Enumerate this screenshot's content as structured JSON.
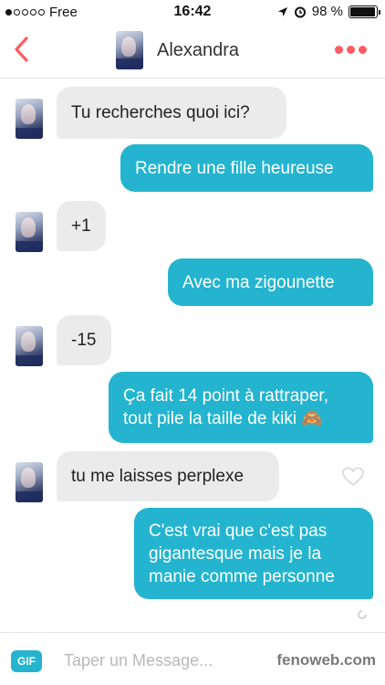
{
  "status_bar": {
    "carrier": "Free",
    "time": "16:42",
    "battery": "98 %",
    "battery_level": 0.98,
    "signal_bars": 1,
    "icons": [
      "location-icon",
      "alarm-icon",
      "battery-icon"
    ]
  },
  "header": {
    "contact_name": "Alexandra",
    "back_icon": "chevron-left-icon",
    "menu_icon": "more-dots-icon"
  },
  "messages": [
    {
      "from": "them",
      "text": "Tu recherches quoi ici?"
    },
    {
      "from": "me",
      "text": "Rendre une fille heureuse"
    },
    {
      "from": "them",
      "text": "+1"
    },
    {
      "from": "me",
      "text": "Avec ma zigounette"
    },
    {
      "from": "them",
      "text": "-15"
    },
    {
      "from": "me",
      "lines": [
        "Ça fait 14 point à rattraper,",
        "tout pile la taille de kiki 🙈"
      ]
    },
    {
      "from": "them",
      "text": "tu me laisses perplexe"
    },
    {
      "from": "me",
      "lines": [
        "C'est vrai que c'est pas",
        "gigantesque mais je la",
        "manie comme personne"
      ]
    }
  ],
  "composer": {
    "gif_label": "GIF",
    "placeholder": "Taper un Message...",
    "watermark": "fenoweb.com"
  },
  "colors": {
    "accent": "#fd5c63",
    "sent_bubble": "#24b4cf",
    "received_bubble": "#ebebeb"
  }
}
